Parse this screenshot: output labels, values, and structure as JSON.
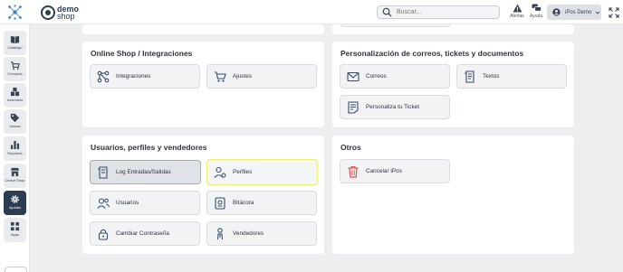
{
  "header": {
    "brand_line1": "demo",
    "brand_line2": "shop",
    "search_placeholder": "Buscar...",
    "alerts_label": "Alertas",
    "help_label": "Ayuda",
    "user_label": "iPos Demo"
  },
  "sidebar": {
    "items": [
      {
        "label": "Catálogo",
        "icon": "book-icon"
      },
      {
        "label": "Compras",
        "icon": "cart-icon"
      },
      {
        "label": "Inventario",
        "icon": "boxes-icon"
      },
      {
        "label": "Ventas",
        "icon": "tag-icon"
      },
      {
        "label": "Reportes",
        "icon": "bar-chart-icon"
      },
      {
        "label": "Online Shop",
        "icon": "store-icon"
      },
      {
        "label": "Ajustes",
        "icon": "gear-icon",
        "active": true
      },
      {
        "label": "Apps",
        "icon": "apps-grid-icon"
      }
    ]
  },
  "sections": {
    "online_shop": {
      "title": "Online Shop / Integraciones",
      "tiles": [
        "Integraciones",
        "Ajustes"
      ]
    },
    "personalizacion": {
      "title": "Personalización de correos, tickets y documentos",
      "tiles": [
        "Correos",
        "Textos",
        "Personaliza tu Ticket"
      ]
    },
    "usuarios": {
      "title": "Usuarios, perfiles y vendedores",
      "tiles": [
        "Log Entradas/Salidas",
        "Perfiles",
        "Usuarios",
        "Bitácora",
        "Cambiar Contraseña",
        "Vendedores"
      ]
    },
    "otros": {
      "title": "Otros",
      "tiles": [
        "Cancelar iPos"
      ]
    }
  },
  "colors": {
    "accent_dark": "#2c3d52",
    "tile_icon": "#3b4a6b",
    "cancel_icon": "#d9534f",
    "highlight": "#eaee71"
  }
}
